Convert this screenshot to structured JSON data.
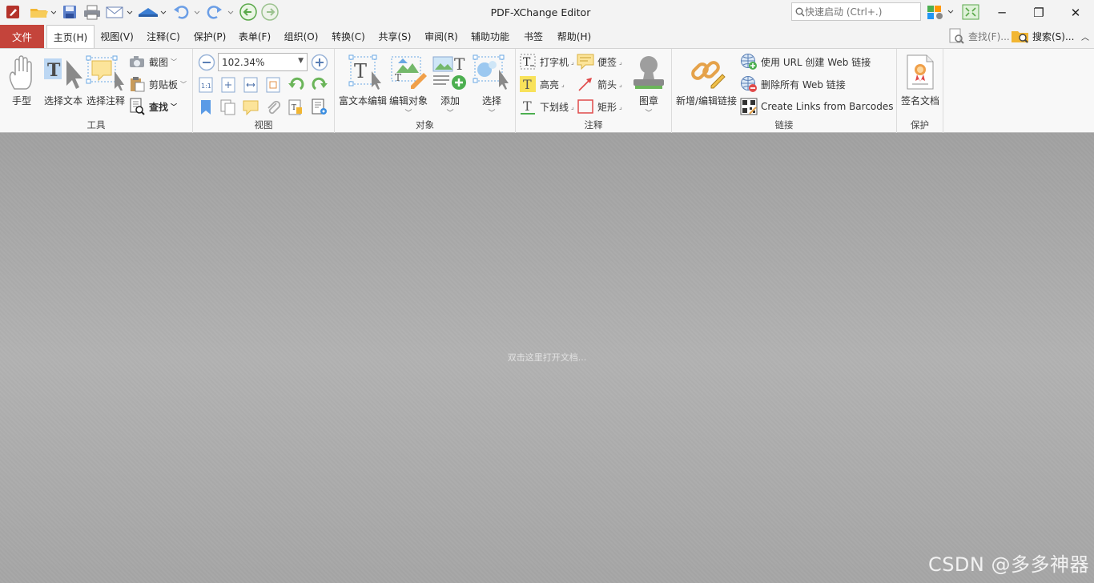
{
  "window": {
    "title": "PDF-XChange Editor",
    "quick_search_placeholder": "快速启动 (Ctrl+.)",
    "minimize": "─",
    "restore": "❐",
    "close": "✕"
  },
  "menu": {
    "file": "文件",
    "items": [
      "主页(H)",
      "视图(V)",
      "注释(C)",
      "保护(P)",
      "表单(F)",
      "组织(O)",
      "转换(C)",
      "共享(S)",
      "审阅(R)",
      "辅助功能",
      "书签",
      "帮助(H)"
    ],
    "find": "查找(F)...",
    "search": "搜索(S)..."
  },
  "ribbon": {
    "tools": {
      "label": "工具",
      "hand": "手型",
      "select_text": "选择文本",
      "select_annot": "选择注释",
      "snapshot": "截图",
      "clipboard": "剪贴板",
      "find": "查找"
    },
    "view": {
      "label": "视图",
      "zoom_value": "102.34%"
    },
    "objects": {
      "label": "对象",
      "rich_text": "富文本编辑",
      "edit_objects": "编辑对象",
      "add": "添加",
      "select": "选择"
    },
    "comment": {
      "label": "注释",
      "typewriter": "打字机",
      "sticky": "便签",
      "highlight": "高亮",
      "arrow": "箭头",
      "underline": "下划线",
      "rectangle": "矩形",
      "stamp": "图章"
    },
    "links": {
      "label": "链接",
      "new_edit": "新增/编辑链接",
      "create_url": "使用 URL 创建 Web 链接",
      "remove_all": "删除所有 Web 链接",
      "barcodes": "Create Links from Barcodes"
    },
    "protect": {
      "label": "保护",
      "sign": "签名文档"
    }
  },
  "canvas": {
    "hint": "双击这里打开文档...",
    "watermark": "CSDN @多多神器"
  },
  "colors": {
    "file_tab": "#c4443b",
    "canvas": "#ababab",
    "accent": "#3a8de0"
  }
}
